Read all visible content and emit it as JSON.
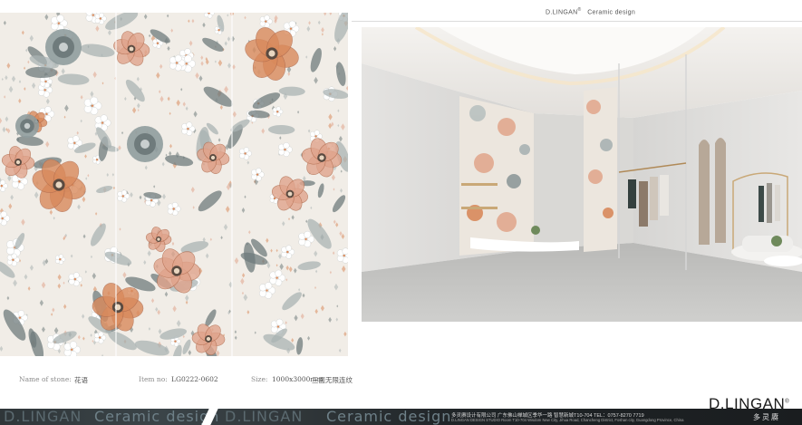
{
  "header": {
    "brand": "D.LINGAN",
    "trademark": "®",
    "tagline": "Ceramic design"
  },
  "product": {
    "name_label": "Name of stone:",
    "name_value": "花语",
    "item_label": "Item no:",
    "item_value": "LG0222-0602",
    "size_label": "Size:",
    "size_value": "1000x3000mm",
    "size_note": "三面无限连纹"
  },
  "footer": {
    "watermark_brand": "D.LINGAN",
    "watermark_tagline": "Ceramic design",
    "address_cn": "多灵赓设计有限公司    广东佛山禅城区季华一路  智慧新城T10-704    TEL：0757-8270 7719",
    "address_en": "D.LINGAN DESIGN STUDIO   Room T10-704 Wisdom New City, Jihua Road, Chancheng District, Foshan city, Guangdong Province, China",
    "logo": "D.LINGAN",
    "logo_mark": "®",
    "logo_sub": "多灵赓"
  },
  "colors": {
    "tile_bg": "#f1ede7",
    "petal_pink": "#e0a48c",
    "petal_orange": "#d98a5c",
    "leaf_grey": "#a9b3b3",
    "leaf_dark": "#6f7b7c",
    "footer_dark": "#1a1d1f"
  },
  "icons": {
    "tiles": "floral-tile-pattern",
    "room": "showroom-render"
  }
}
